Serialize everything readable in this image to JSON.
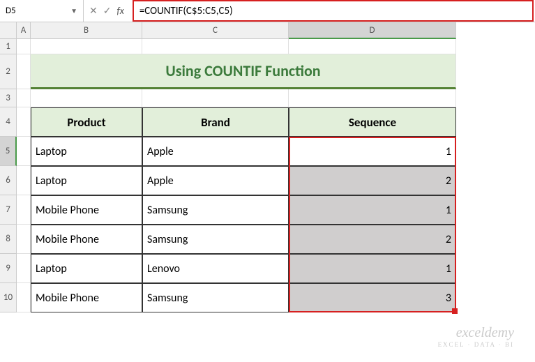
{
  "nameBox": "D5",
  "formula": "=COUNTIF(C$5:C5,C5)",
  "fxLabel": "fx",
  "columns": [
    "A",
    "B",
    "C",
    "D"
  ],
  "activeCol": "D",
  "rows": [
    "1",
    "2",
    "3",
    "4",
    "5",
    "6",
    "7",
    "8",
    "9",
    "10"
  ],
  "activeRow": "5",
  "title": "Using COUNTIF Function",
  "headers": {
    "product": "Product",
    "brand": "Brand",
    "sequence": "Sequence"
  },
  "data": [
    {
      "product": "Laptop",
      "brand": "Apple",
      "sequence": "1"
    },
    {
      "product": "Laptop",
      "brand": "Apple",
      "sequence": "2"
    },
    {
      "product": "Mobile Phone",
      "brand": "Samsung",
      "sequence": "1"
    },
    {
      "product": "Mobile Phone",
      "brand": "Samsung",
      "sequence": "2"
    },
    {
      "product": "Laptop",
      "brand": "Lenovo",
      "sequence": "1"
    },
    {
      "product": "Mobile Phone",
      "brand": "Samsung",
      "sequence": "3"
    }
  ],
  "watermark": {
    "main": "exceldemy",
    "sub": "EXCEL · DATA · BI"
  }
}
